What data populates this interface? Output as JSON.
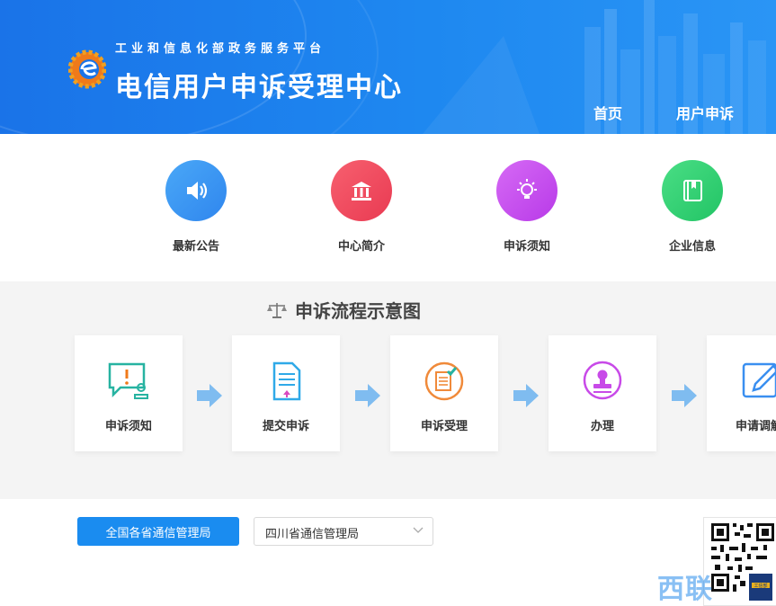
{
  "header": {
    "subtitle": "工业和信息化部政务服务平台",
    "title": "电信用户申诉受理中心",
    "nav": [
      {
        "label": "首页"
      },
      {
        "label": "用户申诉"
      }
    ]
  },
  "quick_links": [
    {
      "label": "最新公告",
      "icon": "speaker-icon",
      "color": "#3a95f3"
    },
    {
      "label": "中心简介",
      "icon": "institution-icon",
      "color": "#f0465c"
    },
    {
      "label": "申诉须知",
      "icon": "lightbulb-icon",
      "color": "#c54ef0"
    },
    {
      "label": "企业信息",
      "icon": "book-icon",
      "color": "#2ecf6f"
    }
  ],
  "process": {
    "title": "申诉流程示意图",
    "steps": [
      {
        "label": "申诉须知",
        "icon": "notice-chat-icon"
      },
      {
        "label": "提交申诉",
        "icon": "submit-document-icon"
      },
      {
        "label": "申诉受理",
        "icon": "accept-document-icon"
      },
      {
        "label": "办理",
        "icon": "stamp-icon"
      },
      {
        "label": "申请调解",
        "icon": "edit-pen-icon"
      }
    ]
  },
  "bottom": {
    "bureau_button": "全国各省通信管理局",
    "province_select": "四川省通信管理局"
  },
  "watermark": "西联",
  "qr": {
    "caption": "工信部"
  }
}
